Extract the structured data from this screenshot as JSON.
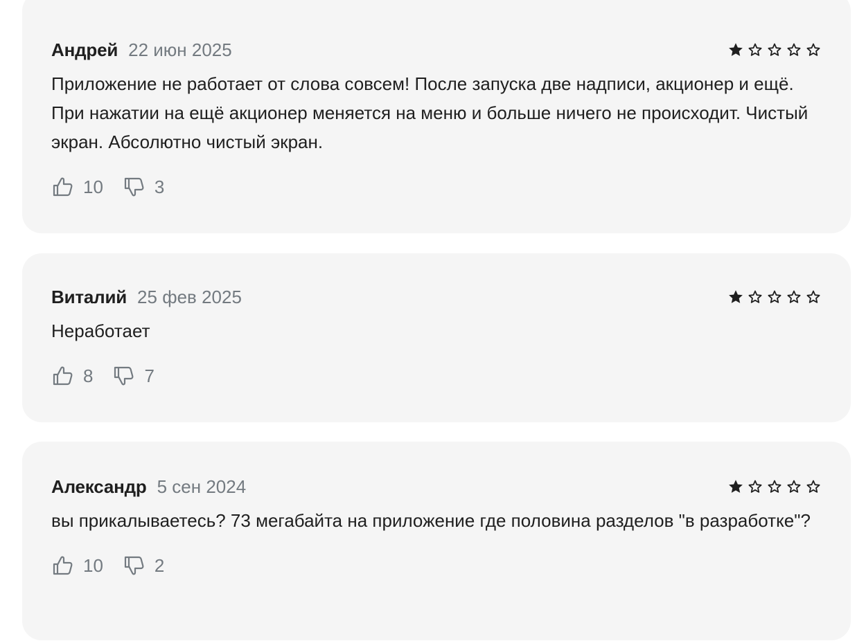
{
  "colors": {
    "card_background": "#f5f5f5",
    "text_primary": "#1f1f1f",
    "text_secondary": "#737a80",
    "star": "#1f1f1f"
  },
  "icons": {
    "star_filled": "star-filled-icon",
    "star_empty": "star-outline-icon",
    "like": "thumbs-up-icon",
    "dislike": "thumbs-down-icon"
  },
  "reviews": [
    {
      "author": "Андрей",
      "date": "22 июн 2025",
      "rating": 1,
      "max_rating": 5,
      "text": "Приложение не работает от слова совсем! После запуска две надписи, акционер и ещё. При нажатии на ещё акционер меняется на меню и больше ничего не происходит. Чистый экран. Абсолютно чистый экран.",
      "likes": "10",
      "dislikes": "3"
    },
    {
      "author": "Виталий",
      "date": "25 фев 2025",
      "rating": 1,
      "max_rating": 5,
      "text": "Неработает",
      "likes": "8",
      "dislikes": "7"
    },
    {
      "author": "Александр",
      "date": "5 сен 2024",
      "rating": 1,
      "max_rating": 5,
      "text": "вы прикалываетесь? 73 мегабайта на приложение где половина разделов \"в разработке\"?",
      "likes": "10",
      "dislikes": "2"
    }
  ]
}
